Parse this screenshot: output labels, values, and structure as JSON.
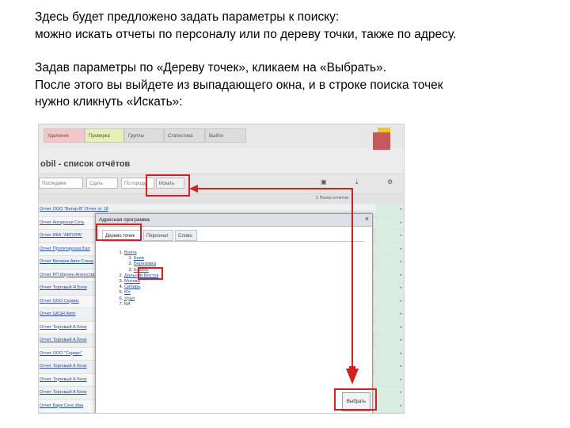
{
  "intro": {
    "line1": "Здесь будет предложено задать параметры к поиску:",
    "line2": "можно искать отчеты по персоналу или по дереву точки, также по адресу.",
    "line3": "Задав параметры по «Дереву точек», кликаем на «Выбрать».",
    "line4": "После этого вы выйдете из выпадающего окна, и в строке поиска точек",
    "line5": "нужно кликнуть «Искать»:"
  },
  "screenshot": {
    "nav": [
      "Удаления",
      "Проверка",
      "Группы",
      "Статистика",
      "Выйти"
    ],
    "app_title": "obil - список отчётов",
    "toolbar": {
      "select1": "Последние",
      "select2": "Сдать",
      "select3": "По городу",
      "search_button": "Искать"
    },
    "list_header_right": "1 Поиск отчетов",
    "rows": [
      "Отчет ООО \"Ветер-В\" Отчет от 18",
      "Отчет Ангарская Сеть",
      "Отчет ИКА \"АВТОРА\"",
      "Отчет Пролетарская Бал",
      "Отчет Ветерок Авто Станц",
      "Отчет РП Изучен Агентство",
      "Отчет Торговый Я Блок",
      "Отчет ООО Сервис",
      "Отчет ЦКЦН Авто",
      "Отчет Торговый А Блок",
      "Отчет Торговый А Блок",
      "Отчет ООО \"Сервис\"",
      "Отчет Торговый А Блок",
      "Отчет Торговый А Блок",
      "Отчет Торговый А Блок",
      "Отчет Бари Сенс Ива",
      "Отчет Ярсь Компании",
      "Отчет Торговый А Блок"
    ],
    "dialog": {
      "title": "Адресная программа",
      "close": "×",
      "tabs": [
        "Дерево точек",
        "Персонал",
        "Слово"
      ],
      "tree": {
        "root": "Волга",
        "children": [
          "Киев",
          "Березовка",
          "Казань"
        ],
        "rest": [
          "Дальний Восток",
          "Москва",
          "Сибирь",
          "Юг",
          "Урал",
          "КИ"
        ]
      },
      "select_button": "Выбрать"
    }
  },
  "colors": {
    "annotation": "#d32020",
    "link": "#2a4d9c",
    "logo_yellow": "#f1c232",
    "logo_red": "#c55a5a"
  }
}
